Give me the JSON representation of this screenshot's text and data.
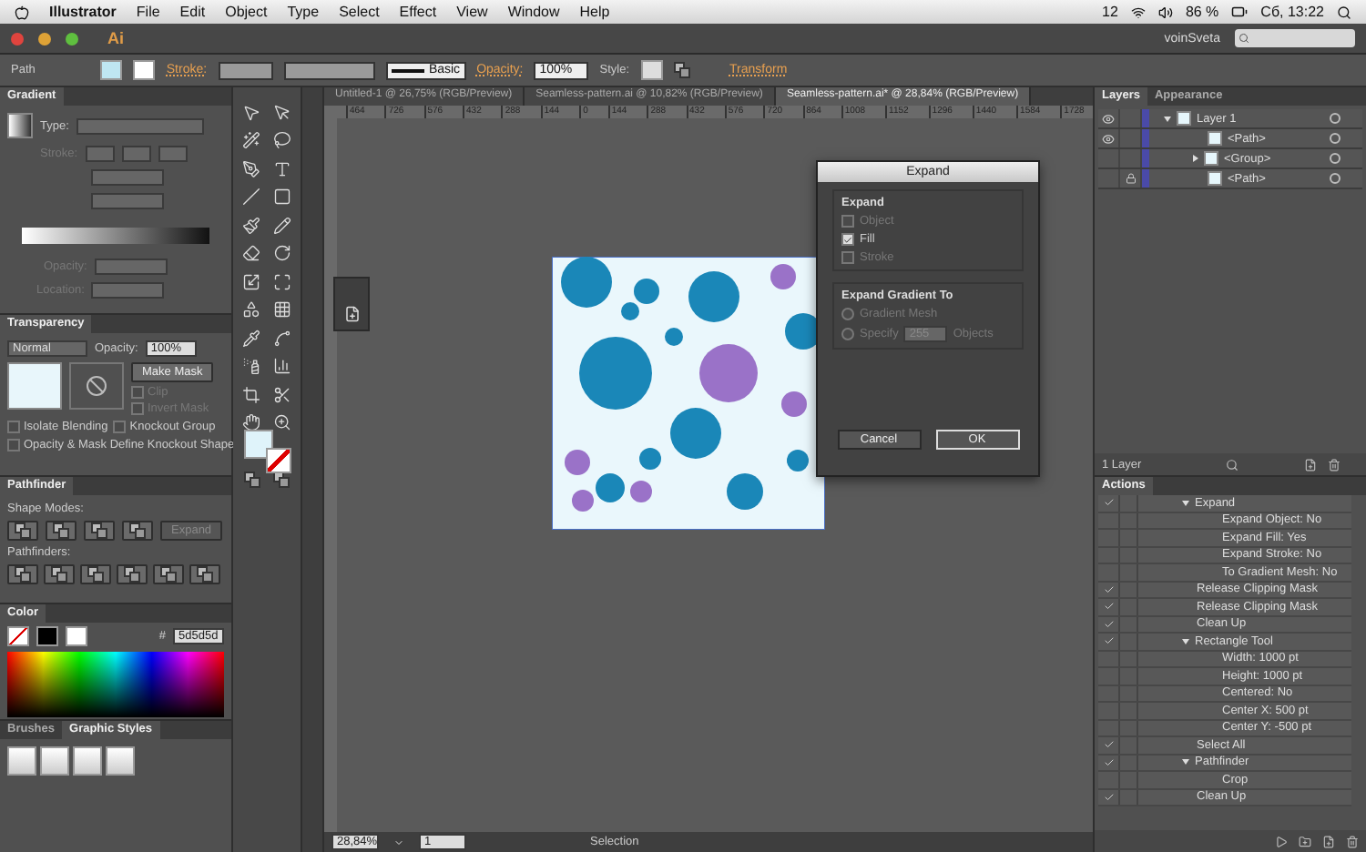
{
  "menu_bar": {
    "app": "Illustrator",
    "items": [
      "File",
      "Edit",
      "Object",
      "Type",
      "Select",
      "Effect",
      "View",
      "Window",
      "Help"
    ],
    "status": {
      "badge": "12",
      "battery": "86 %",
      "clock": "Сб, 13:22"
    }
  },
  "app_bar": {
    "logo": "Ai",
    "workspace": "voinSveta"
  },
  "control_bar": {
    "selection": "Path",
    "stroke_label": "Stroke:",
    "brush": "Basic",
    "opacity_label": "Opacity:",
    "opacity": "100%",
    "style_label": "Style:",
    "transform": "Transform"
  },
  "gradient_panel": {
    "title": "Gradient",
    "type_label": "Type:",
    "stroke_label": "Stroke:",
    "opacity_label": "Opacity:",
    "location_label": "Location:"
  },
  "transparency_panel": {
    "title": "Transparency",
    "blend_mode": "Normal",
    "opacity_label": "Opacity:",
    "opacity": "100%",
    "make_mask": "Make Mask",
    "mask_options": [
      {
        "label": "Clip",
        "checked": false,
        "disabled": true
      },
      {
        "label": "Invert Mask",
        "checked": false,
        "disabled": true
      }
    ],
    "options": [
      {
        "label": "Isolate Blending",
        "checked": false
      },
      {
        "label": "Knockout Group",
        "checked": false
      },
      {
        "label": "Opacity & Mask Define Knockout Shape",
        "checked": false
      }
    ]
  },
  "pathfinder_panel": {
    "title": "Pathfinder",
    "shape_modes_label": "Shape Modes:",
    "expand": "Expand",
    "pathfinders_label": "Pathfinders:"
  },
  "color_panel": {
    "title": "Color",
    "hex_label": "#",
    "hex": "5d5d5d"
  },
  "styles_panel": {
    "tabs": [
      {
        "label": "Brushes",
        "selected": false
      },
      {
        "label": "Graphic Styles",
        "selected": true
      }
    ]
  },
  "document_tabs": [
    {
      "label": "Untitled-1 @ 26,75% (RGB/Preview)",
      "selected": false
    },
    {
      "label": "Seamless-pattern.ai @ 10,82% (RGB/Preview)",
      "selected": false
    },
    {
      "label": "Seamless-pattern.ai* @ 28,84% (RGB/Preview)",
      "selected": true
    }
  ],
  "ruler": {
    "ticks": [
      "464",
      "726",
      "576",
      "432",
      "288",
      "144",
      "0",
      "144",
      "288",
      "432",
      "576",
      "720",
      "864",
      "1008",
      "1152",
      "1296",
      "1440",
      "1584",
      "1728"
    ]
  },
  "expand_dialog": {
    "title": "Expand",
    "expand_group": "Expand",
    "expand_options": [
      {
        "label": "Object",
        "checked": false,
        "disabled": true
      },
      {
        "label": "Fill",
        "checked": true,
        "disabled": false
      },
      {
        "label": "Stroke",
        "checked": false,
        "disabled": true
      }
    ],
    "gradient_group": "Expand Gradient To",
    "gradient_options": [
      {
        "label": "Gradient Mesh",
        "selected": false,
        "disabled": true
      },
      {
        "label": "Specify",
        "selected": false,
        "disabled": true
      }
    ],
    "specify_value": "255",
    "objects_label": "Objects",
    "buttons": [
      {
        "label": "Cancel",
        "kind": "secondary"
      },
      {
        "label": "OK",
        "kind": "default"
      }
    ]
  },
  "status_bar": {
    "zoom": "28,84%",
    "artboard": "1",
    "tool": "Selection"
  },
  "layers_panel": {
    "tabs": [
      {
        "label": "Layers",
        "selected": true
      },
      {
        "label": "Appearance",
        "selected": false
      }
    ],
    "layers": [
      {
        "name": "Layer 1",
        "visible": true,
        "locked": false,
        "expanded": true,
        "children": [
          {
            "name": "<Path>",
            "visible": true,
            "locked": false
          },
          {
            "name": "<Group>",
            "visible": false,
            "locked": false,
            "expanded": false
          },
          {
            "name": "<Path>",
            "visible": false,
            "locked": true
          }
        ]
      }
    ],
    "count": "1 Layer"
  },
  "actions_panel": {
    "title": "Actions",
    "items": [
      {
        "name": "Expand",
        "checked": true,
        "expanded": true,
        "children": [
          {
            "name": "Expand Object: No",
            "checked": false
          },
          {
            "name": "Expand Fill: Yes",
            "checked": false
          },
          {
            "name": "Expand Stroke: No",
            "checked": false
          },
          {
            "name": "To Gradient Mesh: No",
            "checked": false
          }
        ]
      },
      {
        "name": "Release Clipping Mask",
        "checked": true
      },
      {
        "name": "Release Clipping Mask",
        "checked": true
      },
      {
        "name": "Clean Up",
        "checked": true
      },
      {
        "name": "Rectangle Tool",
        "checked": true,
        "expanded": true,
        "children": [
          {
            "name": "Width: 1000 pt",
            "checked": false
          },
          {
            "name": "Height: 1000 pt",
            "checked": false
          },
          {
            "name": "Centered: No",
            "checked": false
          },
          {
            "name": "Center X: 500 pt",
            "checked": false
          },
          {
            "name": "Center Y: -500 pt",
            "checked": false
          }
        ]
      },
      {
        "name": "Select All",
        "checked": true
      },
      {
        "name": "Pathfinder",
        "checked": true,
        "expanded": true,
        "children": [
          {
            "name": "Crop",
            "checked": false
          }
        ]
      },
      {
        "name": "Clean Up",
        "checked": true
      }
    ]
  }
}
